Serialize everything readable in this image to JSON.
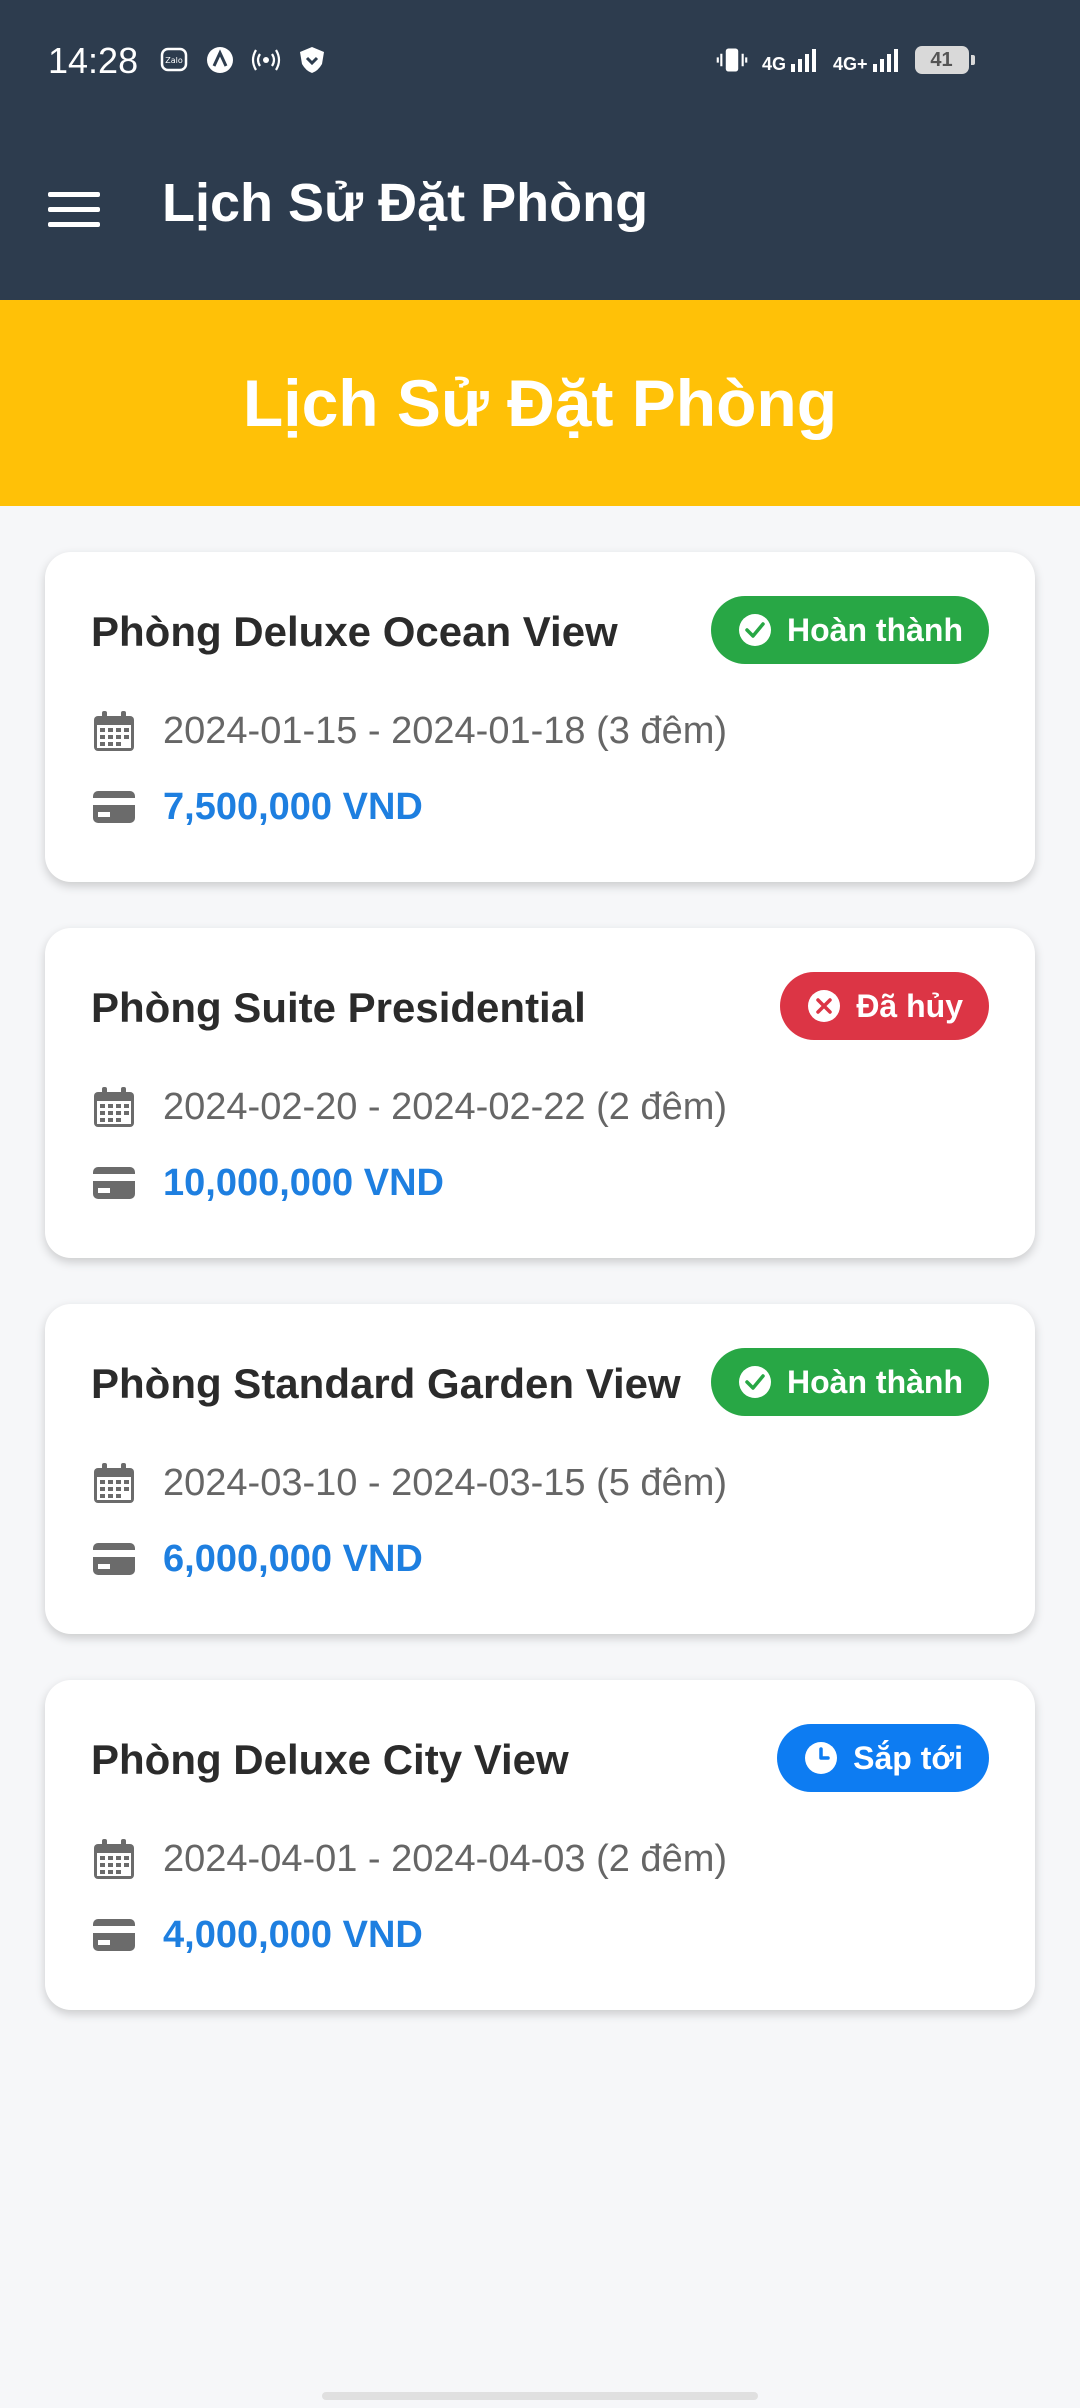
{
  "status_bar": {
    "time": "14:28",
    "network_1": "4G",
    "network_2": "4G+",
    "battery": "41"
  },
  "toolbar": {
    "title": "Lịch Sử Đặt Phòng"
  },
  "banner": {
    "title": "Lịch Sử Đặt Phòng"
  },
  "colors": {
    "appbar": "#2d3c4e",
    "banner": "#ffc107",
    "completed": "#28a745",
    "cancelled": "#dc3545",
    "upcoming": "#0d7cf2",
    "price": "#1e7fe0"
  },
  "bookings": [
    {
      "room": "Phòng Deluxe Ocean View",
      "status": "Hoàn thành",
      "status_icon": "check-circle-icon",
      "dates": "2024-01-15 - 2024-01-18 (3 đêm)",
      "price": "7,500,000 VND"
    },
    {
      "room": "Phòng Suite Presidential",
      "status": "Đã hủy",
      "status_icon": "x-circle-icon",
      "dates": "2024-02-20 - 2024-02-22 (2 đêm)",
      "price": "10,000,000 VND"
    },
    {
      "room": "Phòng Standard Garden View",
      "status": "Hoàn thành",
      "status_icon": "check-circle-icon",
      "dates": "2024-03-10 - 2024-03-15 (5 đêm)",
      "price": "6,000,000 VND"
    },
    {
      "room": "Phòng Deluxe City View",
      "status": "Sắp tới",
      "status_icon": "clock-icon",
      "dates": "2024-04-01 - 2024-04-03 (2 đêm)",
      "price": "4,000,000 VND"
    }
  ]
}
